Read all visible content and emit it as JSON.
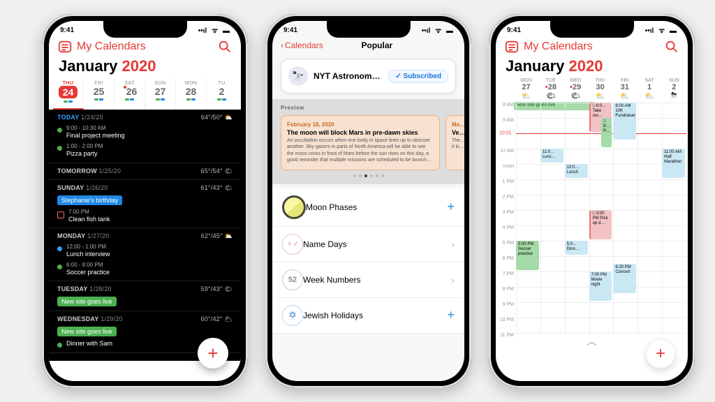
{
  "status": {
    "time": "9:41",
    "signal": "●●●●",
    "wifi": "⏦",
    "batt": "100"
  },
  "p1": {
    "myCalendars": "My Calendars",
    "month": "January",
    "year": "2020",
    "days": [
      {
        "dow": "THU",
        "num": "24",
        "sel": true
      },
      {
        "dow": "FRI",
        "num": "25"
      },
      {
        "dow": "SAT",
        "num": "26",
        "dot": true
      },
      {
        "dow": "SUN",
        "num": "27"
      },
      {
        "dow": "MON",
        "num": "28"
      },
      {
        "dow": "TU",
        "num": "2"
      }
    ],
    "agenda": [
      {
        "head": "TODAY",
        "date": "1/24/20",
        "temp": "64°/50°",
        "wx": "⛅",
        "today": true,
        "items": [
          {
            "dot": "#4caf50",
            "time": "9:00 - 10:30 AM",
            "title": "Final project meeting"
          },
          {
            "dot": "#4caf50",
            "time": "1:00 - 2:00 PM",
            "title": "Pizza party"
          }
        ]
      },
      {
        "head": "TOMORROW",
        "date": "1/25/20",
        "temp": "65°/54°",
        "wx": "🌤",
        "items": []
      },
      {
        "head": "SUNDAY",
        "date": "1/26/20",
        "temp": "61°/43°",
        "wx": "🌤",
        "items": [
          {
            "pill": "blue",
            "title": "Stephanie's birthday"
          },
          {
            "sq": true,
            "time": "7:00 PM",
            "title": "Clean fish tank"
          }
        ]
      },
      {
        "head": "MONDAY",
        "date": "1/27/20",
        "temp": "62°/45°",
        "wx": "⛅",
        "items": [
          {
            "dot": "#2e9fff",
            "time": "12:00 - 1:00 PM",
            "title": "Lunch interview"
          },
          {
            "dot": "#4caf50",
            "time": "6:00 - 8:00 PM",
            "title": "Soccer practice"
          }
        ]
      },
      {
        "head": "TUESDAY",
        "date": "1/28/20",
        "temp": "59°/43°",
        "wx": "🌤",
        "items": [
          {
            "pill": "green",
            "title": "New site goes live"
          }
        ]
      },
      {
        "head": "WEDNESDAY",
        "date": "1/29/20",
        "temp": "60°/42°",
        "wx": "🌥",
        "items": [
          {
            "pill": "green",
            "title": "New site goes live"
          },
          {
            "dot": "#4caf50",
            "time": "",
            "title": "Dinner with Sam"
          }
        ]
      }
    ]
  },
  "p2": {
    "back": "Calendars",
    "title": "Popular",
    "feed": {
      "name": "NYT Astronomy and…",
      "status": "✓ Subscribed"
    },
    "previewLabel": "Preview",
    "card": {
      "date": "February 18, 2020",
      "headline": "The moon will block Mars in pre-dawn skies",
      "body": "An occultation occurs when one body in space lines up to obscure another. Sky gazers in parts of North America will be able to see the moon cross in front of Mars before the sun rises on this day, a good reminder that multiple missions are scheduled to be launch…"
    },
    "card2": {
      "date": "Ma…",
      "headline": "Ve…",
      "body": "The… suf… it lo…"
    },
    "rows": [
      {
        "icon": "moon",
        "label": "Moon Phases",
        "add": true
      },
      {
        "icon": "name",
        "label": "Name Days",
        "chev": true,
        "glyph": "♀♂"
      },
      {
        "icon": "week",
        "label": "Week Numbers",
        "chev": true,
        "glyph": "52"
      },
      {
        "icon": "star",
        "label": "Jewish Holidays",
        "add": true,
        "glyph": "✡"
      }
    ]
  },
  "p3": {
    "myCalendars": "My Calendars",
    "month": "January",
    "year": "2020",
    "days": [
      {
        "dow": "MON",
        "num": "27",
        "wx": "⛅"
      },
      {
        "dow": "TUE",
        "num": "28",
        "wx": "🌤",
        "dot": true
      },
      {
        "dow": "WED",
        "num": "29",
        "wx": "🌤",
        "dot": true
      },
      {
        "dow": "THU",
        "num": "30",
        "wx": "⛅"
      },
      {
        "dow": "FRI",
        "num": "31",
        "wx": "⛅"
      },
      {
        "dow": "SAT",
        "num": "1",
        "wx": "⛅"
      },
      {
        "dow": "SUN",
        "num": "2",
        "wx": "⛈"
      }
    ],
    "allday": {
      "span": 3,
      "label": "New site goes live"
    },
    "hours": [
      "8 AM",
      "9 AM",
      "",
      "11 AM",
      "noon",
      "1 PM",
      "2 PM",
      "3 PM",
      "4 PM",
      "5 PM",
      "6 PM",
      "7 PM",
      "8 PM",
      "9 PM",
      "10 PM",
      "11 PM"
    ],
    "now": "10:01",
    "events": [
      {
        "day": 3,
        "start": 8,
        "end": 10,
        "color": "#f3c2c5",
        "text": "□ 8:0… Take out…",
        "border": "#e57373"
      },
      {
        "day": 4,
        "start": 8,
        "end": 10.5,
        "color": "#cae7f4",
        "text": "8:00 AM 10K Fundraiser"
      },
      {
        "day": 3,
        "start": 9,
        "end": 11,
        "color": "#a4dba8",
        "text": "□ 9:… P…",
        "offset": true
      },
      {
        "day": 1,
        "start": 11,
        "end": 12,
        "color": "#cae7f4",
        "text": "11:0… Lunc…"
      },
      {
        "day": 6,
        "start": 11,
        "end": 13,
        "color": "#cae7f4",
        "text": "11:00 AM Half Marathon"
      },
      {
        "day": 2,
        "start": 12,
        "end": 13,
        "color": "#cae7f4",
        "text": "12:0… Lunch"
      },
      {
        "day": 3,
        "start": 15,
        "end": 17,
        "color": "#f3c2c5",
        "text": "□ 3:00 PM Pick up d…",
        "border": "#e57373"
      },
      {
        "day": 0,
        "start": 17,
        "end": 19,
        "color": "#a4dba8",
        "text": "5:00 PM Soccer practice"
      },
      {
        "day": 2,
        "start": 17,
        "end": 18,
        "color": "#cae7f4",
        "text": "5:0… Dinn…"
      },
      {
        "day": 3,
        "start": 19,
        "end": 21,
        "color": "#cae7f4",
        "text": "7:00 PM Movie night"
      },
      {
        "day": 4,
        "start": 18.5,
        "end": 20.5,
        "color": "#cae7f4",
        "text": "6:30 PM Concert"
      }
    ]
  }
}
